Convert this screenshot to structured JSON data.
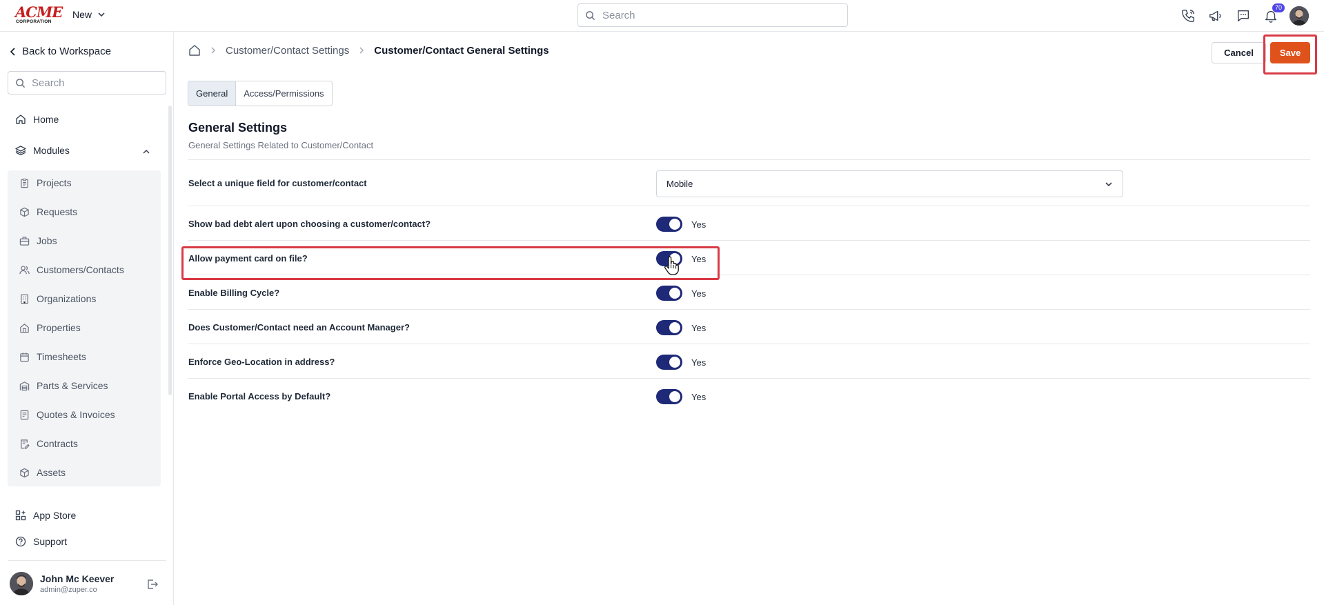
{
  "topbar": {
    "logo_big": "ACME",
    "logo_small": "CORPORATION",
    "new_label": "New",
    "search_placeholder": "Search",
    "notification_count": "70"
  },
  "sidebar": {
    "back_label": "Back to Workspace",
    "search_placeholder": "Search",
    "home_label": "Home",
    "modules_label": "Modules",
    "modules": [
      {
        "label": "Projects",
        "icon": "clipboard-icon"
      },
      {
        "label": "Requests",
        "icon": "box-question-icon"
      },
      {
        "label": "Jobs",
        "icon": "briefcase-icon"
      },
      {
        "label": "Customers/Contacts",
        "icon": "users-icon"
      },
      {
        "label": "Organizations",
        "icon": "building-icon"
      },
      {
        "label": "Properties",
        "icon": "property-icon"
      },
      {
        "label": "Timesheets",
        "icon": "calendar-icon"
      },
      {
        "label": "Parts & Services",
        "icon": "warehouse-icon"
      },
      {
        "label": "Quotes & Invoices",
        "icon": "invoice-icon"
      },
      {
        "label": "Contracts",
        "icon": "contract-icon"
      },
      {
        "label": "Assets",
        "icon": "cube-icon"
      }
    ],
    "app_store_label": "App Store",
    "support_label": "Support",
    "user": {
      "name": "John Mc Keever",
      "email": "admin@zuper.co"
    }
  },
  "breadcrumb": {
    "parent": "Customer/Contact Settings",
    "current": "Customer/Contact General Settings"
  },
  "actions": {
    "cancel": "Cancel",
    "save": "Save"
  },
  "tabs": [
    {
      "label": "General",
      "active": true
    },
    {
      "label": "Access/Permissions",
      "active": false
    }
  ],
  "section": {
    "title": "General Settings",
    "subtitle": "General Settings Related to Customer/Contact"
  },
  "settings": {
    "unique_field": {
      "label": "Select a unique field for customer/contact",
      "value": "Mobile"
    },
    "toggles": [
      {
        "label": "Show bad debt alert upon choosing a customer/contact?",
        "value": "Yes",
        "on": true
      },
      {
        "label": "Allow payment card on file?",
        "value": "Yes",
        "on": true
      },
      {
        "label": "Enable Billing Cycle?",
        "value": "Yes",
        "on": true
      },
      {
        "label": "Does Customer/Contact need an Account Manager?",
        "value": "Yes",
        "on": true
      },
      {
        "label": "Enforce Geo-Location in address?",
        "value": "Yes",
        "on": true
      },
      {
        "label": "Enable Portal Access by Default?",
        "value": "Yes",
        "on": true
      }
    ]
  },
  "colors": {
    "accent": "#e0521c",
    "toggle_on": "#1e2a78",
    "highlight": "#d93a45"
  }
}
